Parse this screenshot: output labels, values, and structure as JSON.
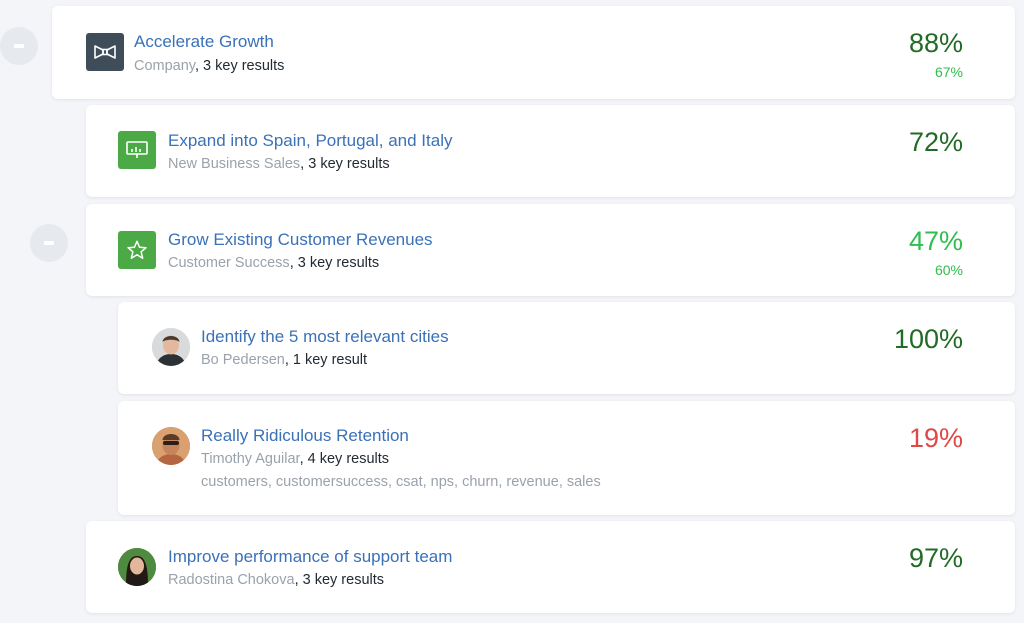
{
  "colors": {
    "dark_green": "#226b25",
    "light_green": "#2fbe4f",
    "red": "#e04848",
    "link_blue": "#3a71b7",
    "muted": "#9aa2ab",
    "company_icon_bg": "#3f4d5a",
    "team_icon_bg": "#4caa46"
  },
  "objectives": [
    {
      "title": "Accelerate Growth",
      "owner": "Company",
      "key_results": ", 3 key results",
      "progress": "88%",
      "progress_value": 88,
      "expected": "67%",
      "icon": "bowtie-icon"
    },
    {
      "title": "Expand into Spain, Portugal, and Italy",
      "owner": "New Business Sales",
      "key_results": ", 3 key results",
      "progress": "72%",
      "progress_value": 72,
      "icon": "chart-board-icon"
    },
    {
      "title": "Grow Existing Customer Revenues",
      "owner": "Customer Success",
      "key_results": ", 3 key results",
      "progress": "47%",
      "progress_value": 47,
      "expected": "60%",
      "icon": "star-icon"
    },
    {
      "title": "Identify the 5 most relevant cities",
      "owner": "Bo Pedersen",
      "key_results": ", 1 key result",
      "progress": "100%",
      "progress_value": 100,
      "icon": "avatar-bo-pedersen"
    },
    {
      "title": "Really Ridiculous Retention",
      "owner": "Timothy Aguilar",
      "key_results": ", 4 key results",
      "progress": "19%",
      "progress_value": 19,
      "tags": "customers, customersuccess, csat, nps, churn, revenue, sales",
      "icon": "avatar-timothy-aguilar"
    },
    {
      "title": "Improve performance of support team",
      "owner": "Radostina Chokova",
      "key_results": ", 3 key results",
      "progress": "97%",
      "progress_value": 97,
      "icon": "avatar-radostina-chokova"
    }
  ]
}
